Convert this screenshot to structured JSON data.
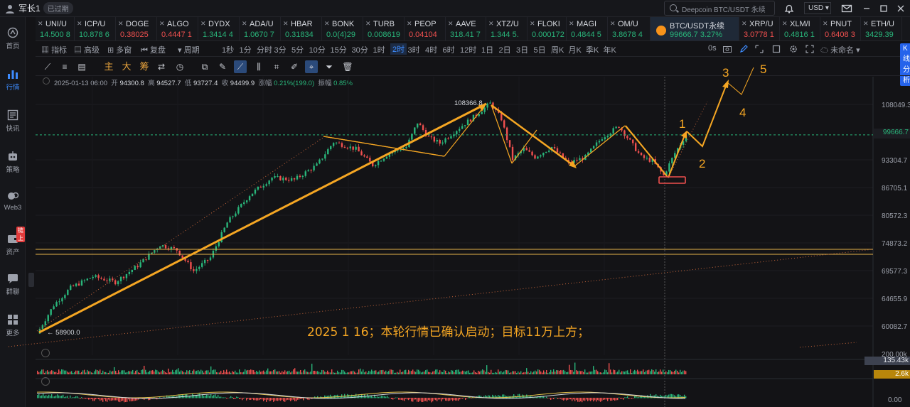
{
  "user": {
    "name": "军长1",
    "status": "已过期"
  },
  "search": {
    "placeholder": "Deepcoin BTC/USDT 永续"
  },
  "currency": "USD",
  "sidebar": [
    {
      "label": "首页",
      "icon": "home-icon"
    },
    {
      "label": "行情",
      "icon": "market-chart-icon",
      "active": true
    },
    {
      "label": "快讯",
      "icon": "news-icon"
    },
    {
      "label": "策略",
      "icon": "robot-icon"
    },
    {
      "label": "Web3",
      "icon": "web3-icon"
    },
    {
      "label": "资产",
      "icon": "wallet-icon",
      "badge": "链上"
    },
    {
      "label": "群聊",
      "icon": "chat-icon"
    },
    {
      "label": "更多",
      "icon": "more-icon"
    }
  ],
  "tickers": [
    {
      "name": "UNI/U",
      "price": "14.500 8",
      "color": "#29b57a"
    },
    {
      "name": "ICP/U",
      "price": "10.878 6",
      "color": "#29b57a"
    },
    {
      "name": "DOGE",
      "price": "0.38025",
      "color": "#f0504f"
    },
    {
      "name": "ALGO",
      "price": "0.4447 1",
      "color": "#f0504f"
    },
    {
      "name": "DYDX",
      "price": "1.3414 4",
      "color": "#29b57a"
    },
    {
      "name": "ADA/U",
      "price": "1.0670 7",
      "color": "#29b57a"
    },
    {
      "name": "HBAR",
      "price": "0.31834",
      "color": "#29b57a"
    },
    {
      "name": "BONK",
      "price": "0.0(4)29",
      "color": "#29b57a"
    },
    {
      "name": "TURB",
      "price": "0.008619",
      "color": "#29b57a"
    },
    {
      "name": "PEOP",
      "price": "0.04104",
      "color": "#f0504f"
    },
    {
      "name": "AAVE",
      "price": "318.41 7",
      "color": "#29b57a"
    },
    {
      "name": "XTZ/U",
      "price": "1.344 5.",
      "color": "#29b57a"
    },
    {
      "name": "FLOKI",
      "price": "0.000172",
      "color": "#29b57a"
    },
    {
      "name": "MAGI",
      "price": "0.4844 5",
      "color": "#29b57a"
    },
    {
      "name": "OM/U",
      "price": "3.8678 4",
      "color": "#29b57a"
    },
    {
      "name": "BTC/USDT永续",
      "price": "99666.7  3.27%",
      "color": "#29b57a",
      "active": true
    },
    {
      "name": "XRP/U",
      "price": "3.0778 1",
      "color": "#f0504f"
    },
    {
      "name": "XLM/I",
      "price": "0.4816 1",
      "color": "#29b57a"
    },
    {
      "name": "PNUT",
      "price": "0.6408 3",
      "color": "#f0504f"
    },
    {
      "name": "ETH/U",
      "price": "3429.39",
      "color": "#29b57a"
    }
  ],
  "toolbar": {
    "indicator": "指标",
    "advanced": "高级",
    "multi": "多窗",
    "replay": "复盘",
    "period": "周期",
    "intervals": [
      "1秒",
      "1分",
      "分时",
      "3分",
      "5分",
      "10分",
      "15分",
      "30分",
      "1时",
      "2时",
      "3时",
      "4时",
      "6时",
      "12时",
      "1日",
      "2日",
      "3日",
      "5日",
      "周K",
      "月K",
      "季K",
      "年K"
    ],
    "active_interval": "2时",
    "countdown": "0s",
    "layout_name": "未命名",
    "kline_btn": "K线分析"
  },
  "drawbar": {
    "main": "主",
    "big": "大",
    "chip": "筹"
  },
  "info": {
    "time": "2025-01-13 06:00",
    "open_label": "开",
    "open": "94300.8",
    "high_label": "高",
    "high": "94527.7",
    "low_label": "低",
    "low": "93727.4",
    "close_label": "收",
    "close": "94499.9",
    "change_label": "涨幅",
    "change": "0.21%(199.0)",
    "amp_label": "振幅",
    "amp": "0.85%"
  },
  "colors": {
    "up": "#29b57a",
    "down": "#f0504f",
    "annotation": "#f5a623",
    "accent": "#3d8bfd"
  },
  "chart_data": {
    "type": "candlestick",
    "symbol": "BTC/USDT永续",
    "interval": "2时",
    "title": "",
    "y_ticks": [
      "108049.3",
      "93304.7",
      "86705.1",
      "80572.3",
      "74873.2",
      "69577.3",
      "64655.9",
      "60082.7"
    ],
    "ylim": [
      56500,
      113000
    ],
    "y_scale": "log",
    "current_price": "99666.7",
    "price_path": [
      [
        0,
        58900
      ],
      [
        3,
        63500
      ],
      [
        6,
        66500
      ],
      [
        10,
        68500
      ],
      [
        14,
        67500
      ],
      [
        18,
        70500
      ],
      [
        22,
        74500
      ],
      [
        25,
        73500
      ],
      [
        28,
        69500
      ],
      [
        31,
        72000
      ],
      [
        34,
        79000
      ],
      [
        38,
        85000
      ],
      [
        42,
        89000
      ],
      [
        46,
        88500
      ],
      [
        50,
        92000
      ],
      [
        53,
        97800
      ],
      [
        57,
        96000
      ],
      [
        60,
        92000
      ],
      [
        63,
        95000
      ],
      [
        66,
        96500
      ],
      [
        68,
        103000
      ],
      [
        70,
        99000
      ],
      [
        72,
        97500
      ],
      [
        75,
        101000
      ],
      [
        78,
        104500
      ],
      [
        81,
        108366.8
      ],
      [
        83,
        104000
      ],
      [
        85,
        93500
      ],
      [
        87,
        96000
      ],
      [
        89,
        94000
      ],
      [
        92,
        96500
      ],
      [
        95,
        92500
      ],
      [
        98,
        94000
      ],
      [
        101,
        99000
      ],
      [
        104,
        102000
      ],
      [
        106,
        98000
      ],
      [
        108,
        94000
      ],
      [
        110,
        93000
      ],
      [
        112,
        89500
      ],
      [
        114,
        95000
      ],
      [
        116,
        99666.7
      ]
    ],
    "annotations": {
      "high_label": "108366.8",
      "low_label": "58900.0",
      "wave_labels": [
        "1",
        "2",
        "3",
        "4",
        "5"
      ],
      "note": "2025 1 16；本轮行情已确认启动；目标11万上方；"
    },
    "volume_axis": {
      "label": "200.00k",
      "current": "135.43k"
    },
    "oscillator_axis": {
      "current": "2.6k",
      "zero": "0.00"
    }
  }
}
